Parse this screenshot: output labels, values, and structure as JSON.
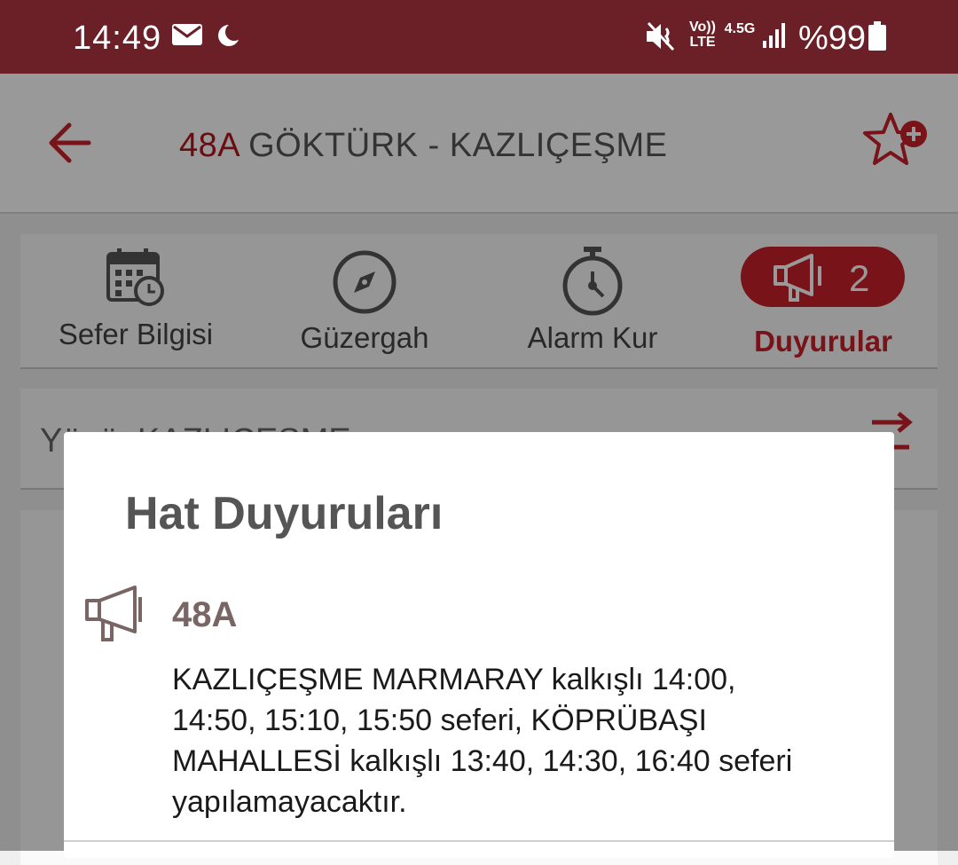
{
  "status_bar": {
    "time": "14:49",
    "battery": "%99",
    "network_voice": "Vo)) LTE",
    "network_type": "4.5G",
    "icons": [
      "mail-icon",
      "moon-icon",
      "mute-icon",
      "volte-icon",
      "signal-icon",
      "battery-icon"
    ]
  },
  "app_bar": {
    "line_code": "48A",
    "route": "GÖKTÜRK - KAZLIÇEŞME",
    "back_icon": "back-arrow-icon",
    "favorite_icon": "star-add-icon"
  },
  "tabs": [
    {
      "label": "Sefer Bilgisi",
      "icon": "calendar-clock-icon"
    },
    {
      "label": "Güzergah",
      "icon": "compass-icon"
    },
    {
      "label": "Alarm Kur",
      "icon": "stopwatch-icon"
    },
    {
      "label": "Duyurular",
      "icon": "megaphone-icon",
      "badge": "2",
      "active": true
    }
  ],
  "direction": {
    "text": "Yönü: KAZLIÇEŞME",
    "swap_icon": "swap-direction-icon"
  },
  "dialog": {
    "title": "Hat Duyuruları",
    "announcement": {
      "line": "48A",
      "lines": [
        "KAZLIÇEŞME MARMARAY kalkışlı 14:00,",
        "14:50, 15:10, 15:50 seferi, KÖPRÜBAŞI",
        "MAHALLESİ kalkışlı 13:40, 14:30, 16:40 seferi",
        "yapılamayacaktır."
      ]
    }
  },
  "colors": {
    "status_bar": "#6b1f27",
    "accent": "#c8202c",
    "title_text": "#555555"
  }
}
